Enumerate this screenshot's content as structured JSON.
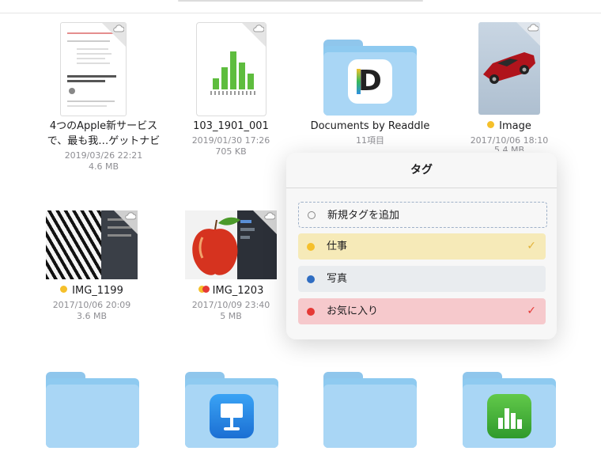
{
  "files": [
    {
      "name_line1": "4つのApple新サービス",
      "name_line2": "で、最も我…ゲットナビ",
      "date": "2019/03/26 22:21",
      "size": "4.6 MB"
    },
    {
      "name": "103_1901_001",
      "date": "2019/01/30 17:26",
      "size": "705 KB"
    },
    {
      "name": "Documents by Readdle",
      "info": "11項目"
    },
    {
      "name": "Image",
      "date": "2017/10/06 18:10",
      "size": "5.4 MB",
      "tag_color": "#f5c02b"
    },
    {
      "name": "IMG_1199",
      "date": "2017/10/06 20:09",
      "size": "3.6 MB",
      "tag_color": "#f5c02b"
    },
    {
      "name": "IMG_1203",
      "date": "2017/10/09 23:40",
      "size": "5 MB",
      "tag_colors": [
        "#f5c02b",
        "#e53935"
      ]
    }
  ],
  "tag_popup": {
    "title": "タグ",
    "new_tag_label": "新規タグを追加",
    "tags": [
      {
        "label": "仕事",
        "color": "#f5c02b",
        "checked": true,
        "check_color": "#e2b23a",
        "bg": "#f6eab8"
      },
      {
        "label": "写真",
        "color": "#2f6dc2",
        "checked": false,
        "bg": "#e9ecef"
      },
      {
        "label": "お気に入り",
        "color": "#e53935",
        "checked": true,
        "check_color": "#e53935",
        "bg": "#f6c9cc"
      }
    ]
  },
  "icons": [
    "cloud-download-icon",
    "numbers-app-icon",
    "documents-app-icon",
    "keynote-app-icon",
    "folder-icon",
    "checkmark-icon"
  ]
}
